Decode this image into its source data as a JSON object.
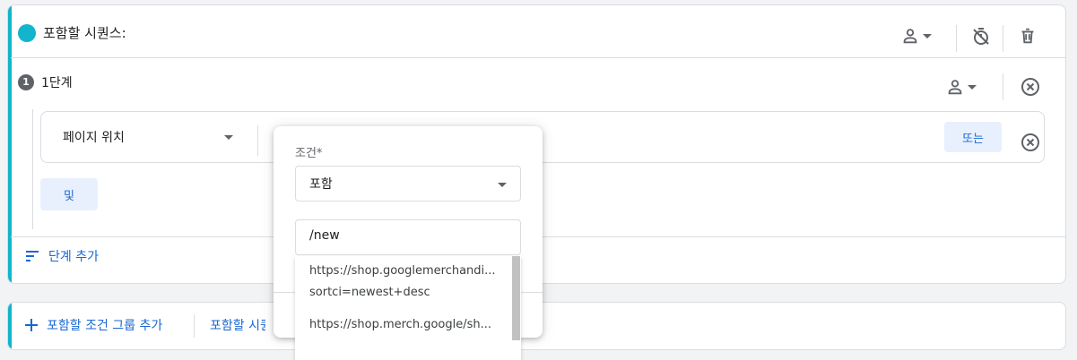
{
  "sequence": {
    "title": "포함할 시퀀스:"
  },
  "step": {
    "number": "1",
    "title": "1단계"
  },
  "condition": {
    "dimension": "페이지 위치",
    "or_label": "또는",
    "and_label": "및"
  },
  "actions": {
    "add_step": "단계 추가",
    "add_group": "포함할 조건 그룹 추가",
    "add_sequence": "포함할 시퀀스 추가"
  },
  "popup": {
    "condition_label": "조건*",
    "operator": "포함",
    "value": "/new",
    "suggestions": [
      {
        "line1": "https://shop.googlemerchandi...",
        "line2": "sortci=newest+desc"
      },
      {
        "line1": "https://shop.merch.google/sh..."
      }
    ]
  },
  "colors": {
    "accent": "#12b5cb",
    "link": "#1967d2",
    "tonal": "#e8f0fe"
  }
}
